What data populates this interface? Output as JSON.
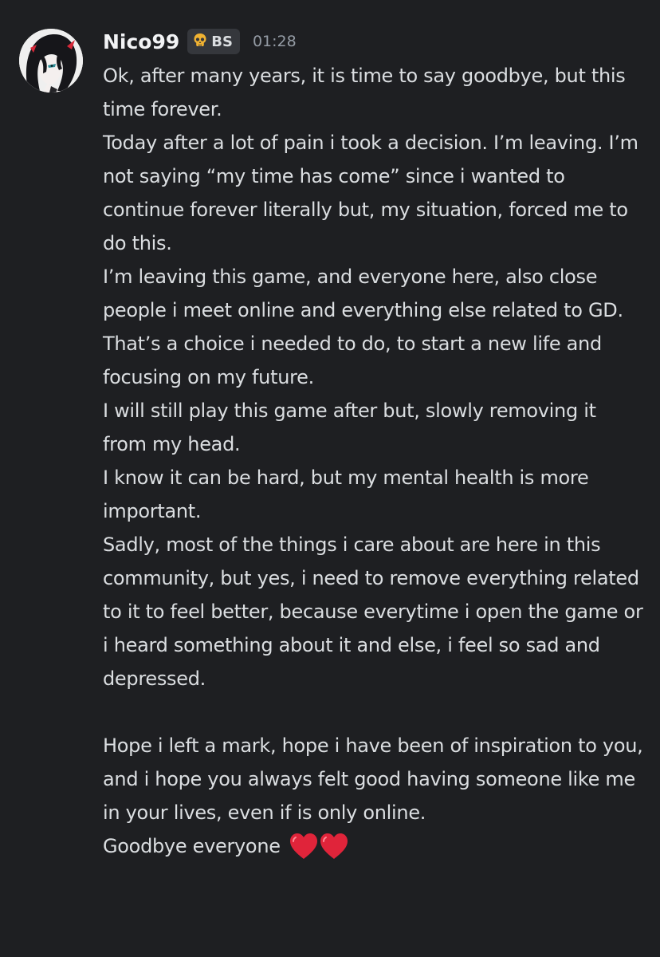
{
  "message": {
    "author": {
      "name": "Nico99",
      "avatar_icon": "anime-character-avatar",
      "tag": {
        "icon": "skull-icon",
        "text": "BS"
      }
    },
    "timestamp": "01:28",
    "lines": [
      "Ok, after many years, it is time to say goodbye, but this time forever.",
      "Today after a lot of pain i took a decision. I’m leaving. I’m not saying “my time has come” since i wanted to continue forever literally but, my situation, forced me to do this.",
      "I’m leaving this game, and everyone here, also close people i meet online and everything else related to GD.",
      "That’s a choice i needed to do, to start a new life and focusing on my future.",
      "I will still play this game after but, slowly removing it from my head.",
      "I know it can be hard, but my mental health is more important.",
      "Sadly, most of the things i care about are here in this community, but yes, i need to remove everything related to it to feel better, because everytime i open the game or i heard something about it and else, i feel so sad and depressed.",
      "Hope i left a mark, hope i have been of inspiration to you, and i hope you always felt good having someone like me in your lives, even if is only online."
    ],
    "last_line": "Goodbye everyone",
    "emojis": [
      "red-heart-emoji",
      "red-heart-emoji"
    ]
  },
  "colors": {
    "background": "#1e1f22",
    "text": "#dbdee1",
    "username": "#f2f3f5",
    "timestamp": "#949ba4",
    "tag_background": "#35373c",
    "heart": "#e0243a"
  }
}
